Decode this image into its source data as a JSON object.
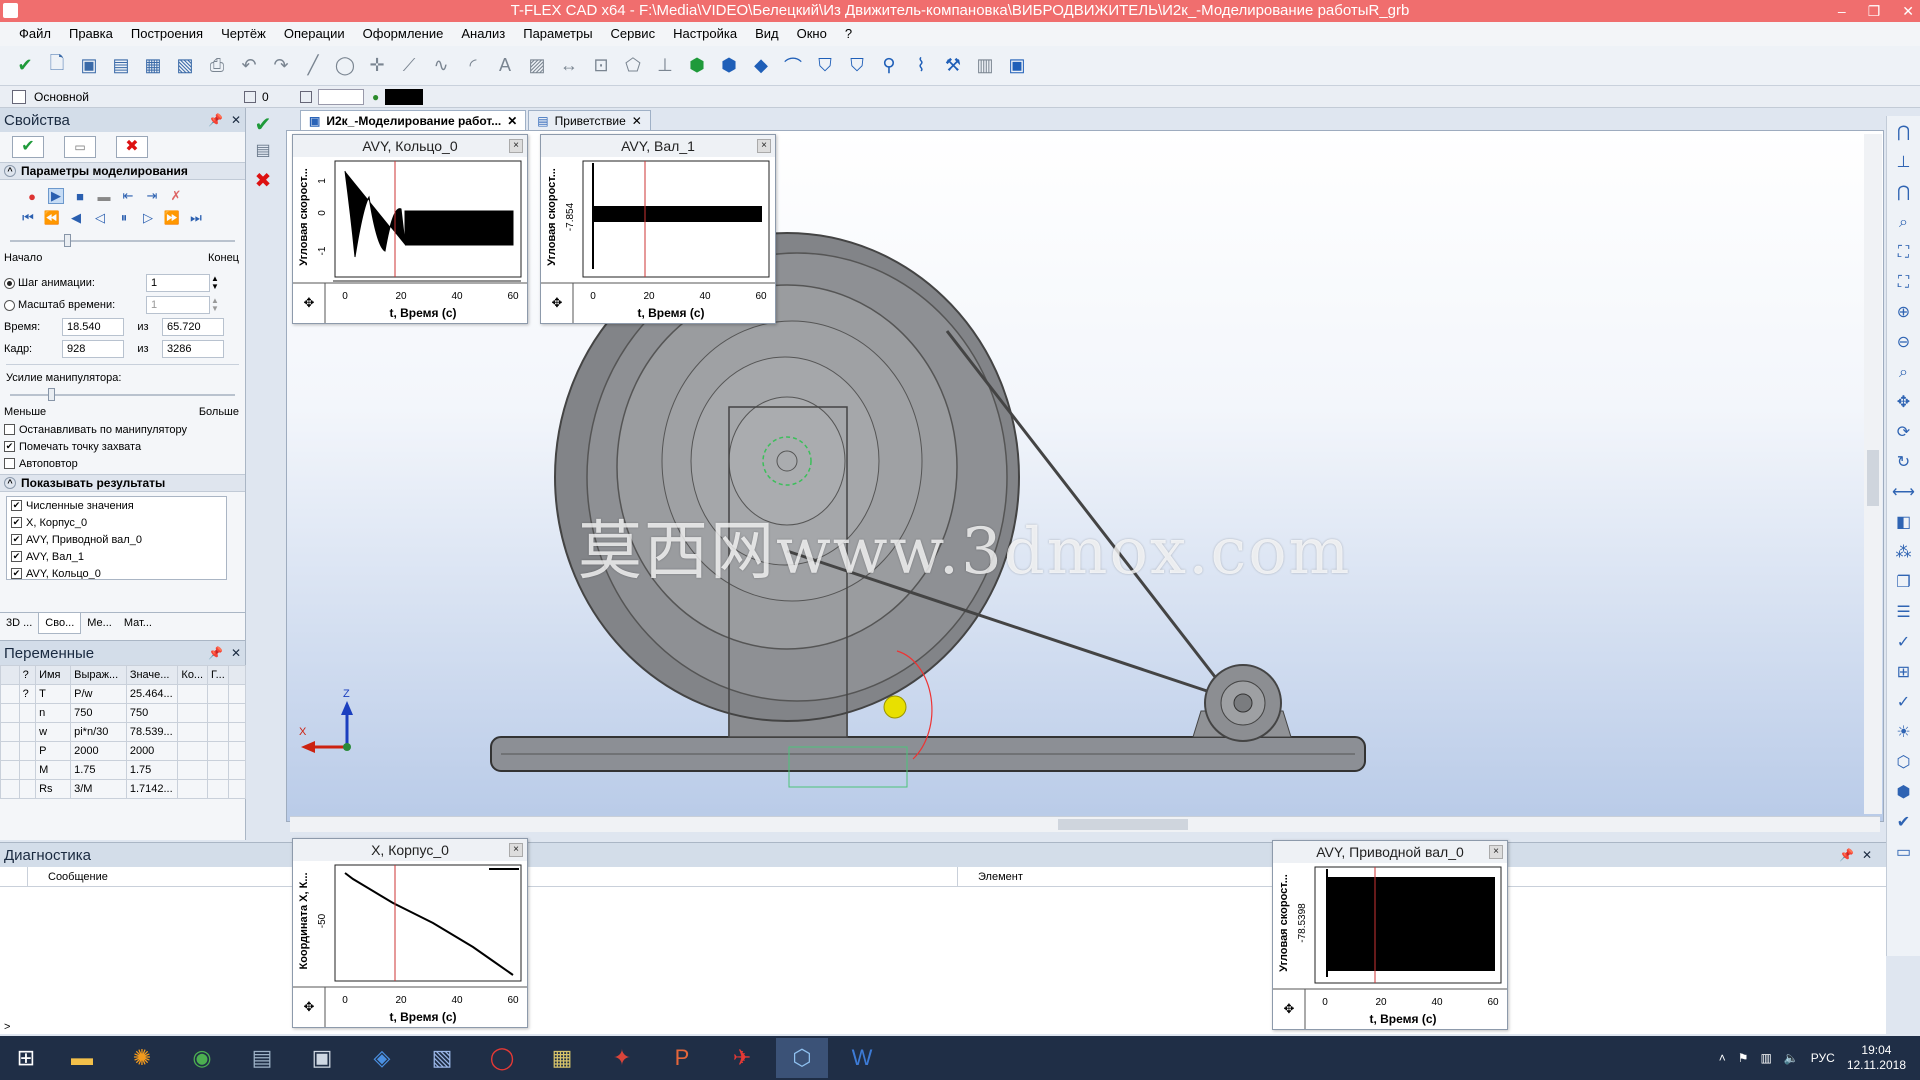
{
  "window": {
    "title": "T-FLEX CAD x64 - F:\\Media\\VIDEO\\Белецкий\\Из Движитель-компановка\\ВИБРОДВИЖИТЕЛЬ\\И2к_-Моделирование работыR_grb"
  },
  "menu": [
    "Файл",
    "Правка",
    "Построения",
    "Чертёж",
    "Операции",
    "Оформление",
    "Анализ",
    "Параметры",
    "Сервис",
    "Настройка",
    "Вид",
    "Окно",
    "?"
  ],
  "layerbar": {
    "layer": "Основной",
    "level": "0"
  },
  "props": {
    "title": "Свойства",
    "section_sim": "Параметры моделирования",
    "start_label": "Начало",
    "end_label": "Конец",
    "anim_step_label": "Шаг анимации:",
    "anim_step_value": "1",
    "time_scale_label": "Масштаб времени:",
    "time_scale_value": "1",
    "time_label": "Время:",
    "time_value": "18.540",
    "of": "из",
    "time_total": "65.720",
    "frame_label": "Кадр:",
    "frame_value": "928",
    "frame_total": "3286",
    "force_label": "Усилие манипулятора:",
    "less": "Меньше",
    "more": "Больше",
    "chk_stop": "Останавливать по манипулятору",
    "chk_mark": "Помечать точку захвата",
    "chk_repeat": "Автоповтор",
    "section_results": "Показывать результаты",
    "results": [
      "Численные значения",
      "X, Корпус_0",
      "AVY, Приводной вал_0",
      "AVY, Вал_1",
      "AVY, Кольцо_0"
    ],
    "bottom_tabs": [
      "3D ...",
      "Сво...",
      "Ме...",
      "Мат..."
    ]
  },
  "vars": {
    "title": "Переменные",
    "headers": [
      "",
      "?",
      "Имя",
      "Выраж...",
      "Значе...",
      "Ко...",
      "Г...",
      ""
    ],
    "rows": [
      [
        "",
        "?",
        "T",
        "P/w",
        "25.464..."
      ],
      [
        "",
        "",
        "n",
        "750",
        "750"
      ],
      [
        "",
        "",
        "w",
        "pi*n/30",
        "78.539..."
      ],
      [
        "",
        "",
        "P",
        "2000",
        "2000"
      ],
      [
        "",
        "",
        "M",
        "1.75",
        "1.75"
      ],
      [
        "",
        "",
        "Rs",
        "3/M",
        "1.7142..."
      ]
    ]
  },
  "tabs": [
    "И2к_-Моделирование работ...",
    "Приветствие"
  ],
  "diag": {
    "title": "Диагностика",
    "col_message": "Сообщение",
    "col_element": "Элемент"
  },
  "plots": {
    "ring": {
      "title": "AVY, Кольцо_0",
      "ylabel": "Угловая скорост...",
      "xlabel": "t, Время (с)",
      "y1": "1",
      "y2": "0",
      "y3": "-1"
    },
    "shaft1": {
      "title": "AVY, Вал_1",
      "ylabel": "Угловая скорост...",
      "xlabel": "t, Время (с)",
      "y1": "-7.854"
    },
    "body": {
      "title": "X, Корпус_0",
      "ylabel": "Координата X, К...",
      "xlabel": "t, Время (с)",
      "y1": "-50"
    },
    "drive": {
      "title": "AVY, Приводной вал_0",
      "ylabel": "Угловая скорост...",
      "xlabel": "t, Время (с)",
      "y1": "-78.5398"
    }
  },
  "ticks": [
    "0",
    "20",
    "40",
    "60"
  ],
  "watermark": "莫西网www.3dmox.com",
  "axes": {
    "z": "Z",
    "x": "X"
  },
  "clock": {
    "lang": "РУС",
    "time": "19:04",
    "date": "12.11.2018"
  }
}
